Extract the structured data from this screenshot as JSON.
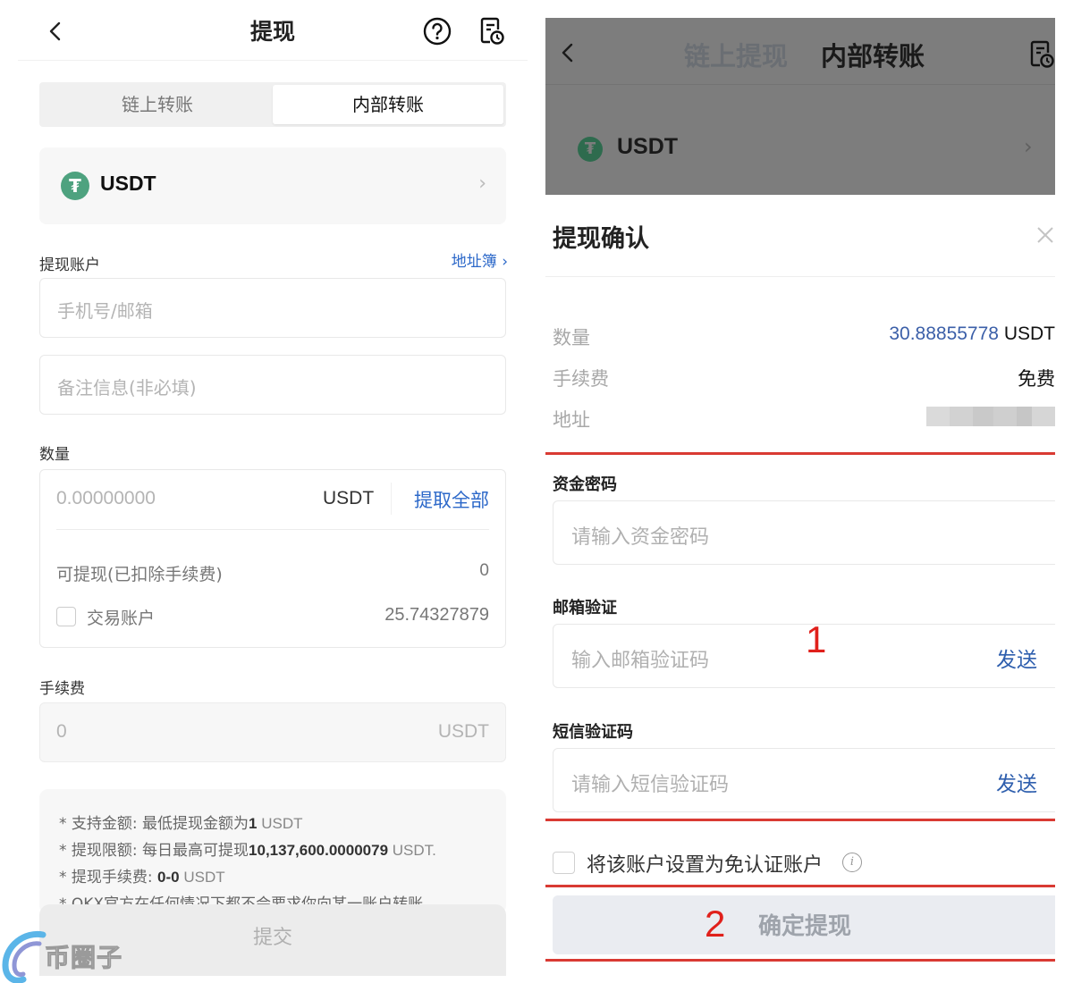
{
  "left": {
    "header": {
      "title": "提现",
      "icons": [
        "back-chevron-icon",
        "help-circle-icon",
        "history-record-icon"
      ]
    },
    "tabs": [
      {
        "label": "链上转账",
        "active": false
      },
      {
        "label": "内部转账",
        "active": true
      }
    ],
    "coin": {
      "symbol": "USDT",
      "icon": "tether-icon"
    },
    "account": {
      "label": "提现账户",
      "address_book_link": "地址簿 ›",
      "account_placeholder": "手机号/邮箱",
      "memo_placeholder": "备注信息(非必填)"
    },
    "amount": {
      "label": "数量",
      "placeholder": "0.00000000",
      "unit": "USDT",
      "withdraw_all": "提取全部",
      "available_label": "可提现(已扣除手续费)",
      "available_value": "0",
      "trade_account_label": "交易账户",
      "trade_account_value": "25.74327879",
      "trade_account_checked": false
    },
    "fee": {
      "label": "手续费",
      "value": "0",
      "unit": "USDT"
    },
    "notes": [
      {
        "prefix": "* 支持金额: 最低提现金额为",
        "bold": "1",
        "suffix": " USDT"
      },
      {
        "prefix": "* 提现限额: 每日最高可提现",
        "bold": "10,137,600.0000079",
        "suffix": " USDT."
      },
      {
        "prefix": "* 提现手续费: ",
        "bold": "0-0",
        "suffix": " USDT"
      },
      {
        "prefix": "* OKX官方在任何情况下都不会要求你向某一账户转账",
        "bold": "",
        "suffix": ""
      }
    ],
    "submit_label": "提交",
    "watermark": "币圈子"
  },
  "right": {
    "background_header": {
      "tab_inactive": "链上提现",
      "tab_active": "内部转账",
      "coin": "USDT"
    },
    "sheet": {
      "title": "提现确认",
      "summary": [
        {
          "label": "数量",
          "value": "30.88855778",
          "unit": "USDT"
        },
        {
          "label": "手续费",
          "value": "免费"
        },
        {
          "label": "地址",
          "value": "",
          "masked": true
        }
      ],
      "fund_password": {
        "label": "资金密码",
        "placeholder": "请输入资金密码"
      },
      "email_verify": {
        "label": "邮箱验证",
        "placeholder": "输入邮箱验证码",
        "send": "发送"
      },
      "sms_verify": {
        "label": "短信验证码",
        "placeholder": "请输入短信验证码",
        "send": "发送"
      },
      "trust_account": {
        "label": "将该账户设置为免认证账户",
        "checked": false
      },
      "confirm_label": "确定提现",
      "annotations": [
        "1",
        "2"
      ]
    },
    "colors": {
      "accent_blue": "#2c68c9",
      "annotation_red": "#d93a33",
      "tether_green": "#4ea27f"
    }
  }
}
